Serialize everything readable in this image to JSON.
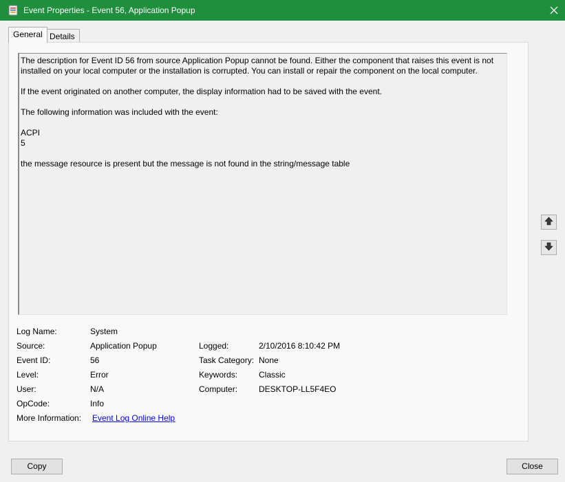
{
  "window": {
    "title": "Event Properties - Event 56, Application Popup",
    "icon": "event-viewer-icon",
    "close_icon": "close-icon",
    "accent_color": "#1f8f3e"
  },
  "tabs": [
    {
      "label": "General",
      "selected": true
    },
    {
      "label": "Details",
      "selected": false
    }
  ],
  "description": {
    "line1": "The description for Event ID 56 from source Application Popup cannot be found. Either the component that raises this event is not installed on your local computer or the installation is corrupted. You can install or repair the component on the local computer.",
    "line2": "If the event originated on another computer, the display information had to be saved with the event.",
    "line3": "The following information was included with the event:",
    "line4": "ACPI",
    "line5": "5",
    "line6": "the message resource is present but the message is not found in the string/message table"
  },
  "properties": {
    "log_name_label": "Log Name:",
    "log_name": "System",
    "source_label": "Source:",
    "source": "Application Popup",
    "logged_label": "Logged:",
    "logged": "2/10/2016 8:10:42 PM",
    "event_id_label": "Event ID:",
    "event_id": "56",
    "task_category_label": "Task Category:",
    "task_category": "None",
    "level_label": "Level:",
    "level": "Error",
    "keywords_label": "Keywords:",
    "keywords": "Classic",
    "user_label": "User:",
    "user": "N/A",
    "computer_label": "Computer:",
    "computer": "DESKTOP-LL5F4EO",
    "opcode_label": "OpCode:",
    "opcode": "Info",
    "more_info_label": "More Information:",
    "more_info_link": "Event Log Online Help"
  },
  "nav": {
    "up_icon": "arrow-up-icon",
    "down_icon": "arrow-down-icon"
  },
  "buttons": {
    "copy": "Copy",
    "close": "Close"
  }
}
